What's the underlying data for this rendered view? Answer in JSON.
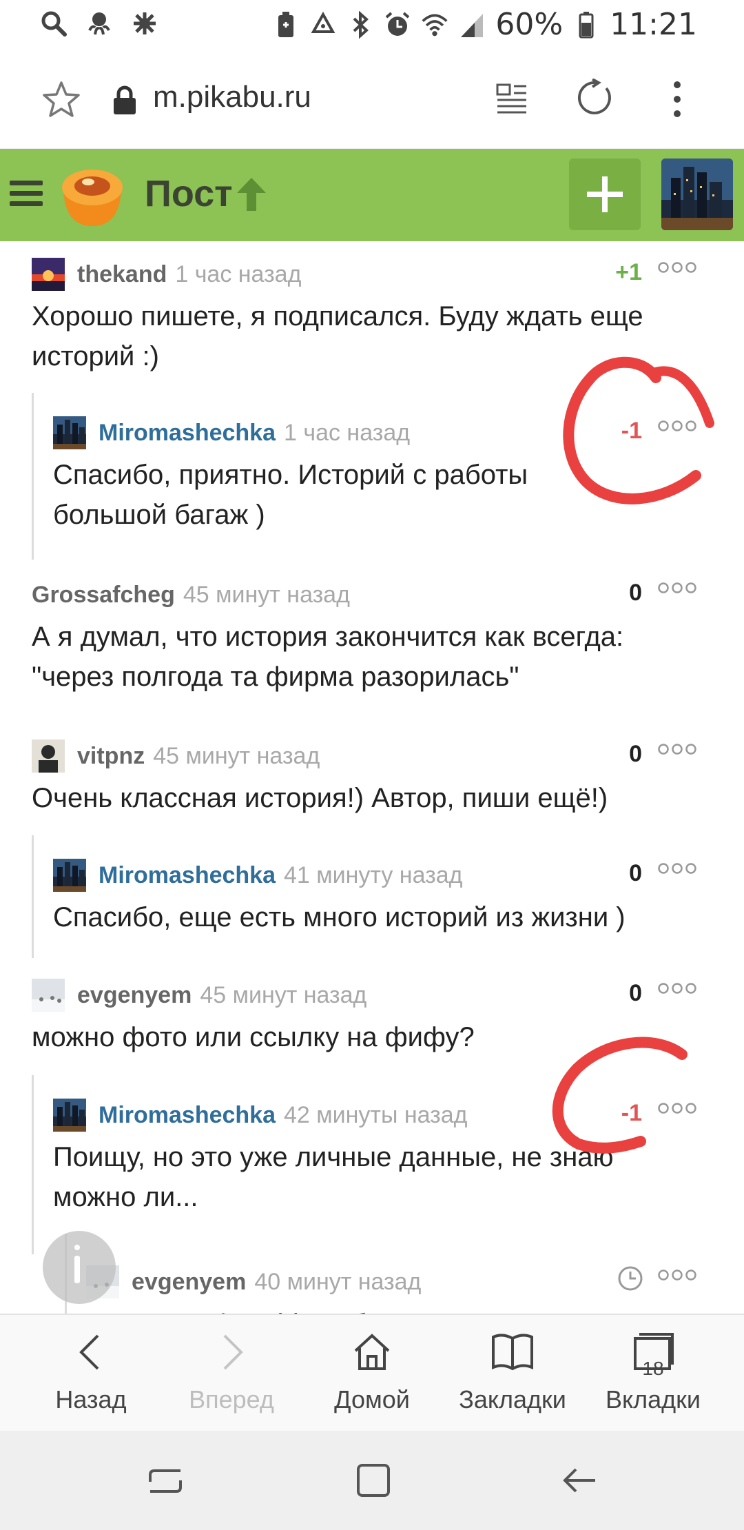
{
  "status_bar": {
    "battery": "60%",
    "time": "11:21",
    "left_icons": [
      "search-icon",
      "octopus-icon",
      "settings-icon"
    ],
    "right_icons": [
      "battery-saver-icon",
      "recycle-icon",
      "bluetooth-icon",
      "alarm-icon",
      "wifi-icon",
      "signal-icon"
    ]
  },
  "browser": {
    "url": "m.pikabu.ru"
  },
  "header": {
    "title": "Пост",
    "accent": "#8dc255"
  },
  "comments": [
    {
      "author": "thekand",
      "time": "1 час назад",
      "score": "+1",
      "text_lines": [
        "Хорошо пишете, я подписался. Буду ждать еще",
        "историй :)"
      ]
    },
    {
      "author": "Miromashechka",
      "time": "1 час назад",
      "score": "-1",
      "text_lines": [
        "Спасибо, приятно. Историй с работы",
        "большой багаж )"
      ]
    },
    {
      "author": "Grossafcheg",
      "time": "45 минут назад",
      "score": "0",
      "text_lines": [
        "А я думал, что история закончится как всегда:",
        "\"через полгода та фирма разорилась\""
      ]
    },
    {
      "author": "vitpnz",
      "time": "45 минут назад",
      "score": "0",
      "text_lines": [
        "Очень классная история!) Автор, пиши ещё!)"
      ]
    },
    {
      "author": "Miromashechka",
      "time": "41 минуту назад",
      "score": "0",
      "text_lines": [
        "Спасибо, еще есть много историй из жизни )"
      ]
    },
    {
      "author": "evgenyem",
      "time": "45 минут назад",
      "score": "0",
      "text_lines": [
        "можно фото или ссылку на фифу?"
      ]
    },
    {
      "author": "Miromashechka",
      "time": "42 минуты назад",
      "score": "-1",
      "text_lines": [
        "Поищу, но это уже личные данные, не знаю",
        "можно ли..."
      ]
    },
    {
      "author": "evgenyem",
      "time": "40 минут назад",
      "score": "",
      "text_lines": [
        "просто цифры id, любопытство и чувство"
      ]
    }
  ],
  "bottom_nav": [
    {
      "label": "Назад",
      "icon": "back-icon"
    },
    {
      "label": "Вперед",
      "icon": "forward-icon"
    },
    {
      "label": "Домой",
      "icon": "home-icon"
    },
    {
      "label": "Закладки",
      "icon": "bookmarks-icon"
    },
    {
      "label": "Вкладки",
      "icon": "tabs-icon",
      "count": "18"
    }
  ],
  "colors": {
    "positive": "#6cb047",
    "negative": "#e05555",
    "author_link": "#2f6e9a",
    "annotation": "#e8413f"
  }
}
